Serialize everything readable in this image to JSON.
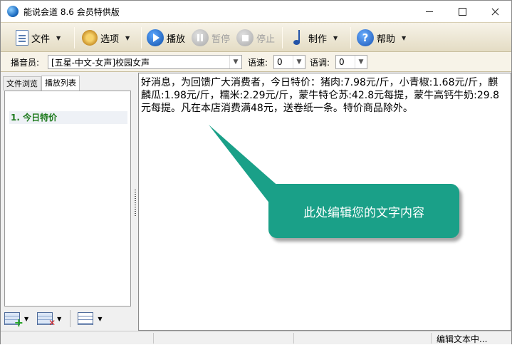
{
  "window": {
    "title": "能说会道 8.6 会员特供版"
  },
  "toolbar": {
    "file_label": "文件",
    "options_label": "选项",
    "play_label": "播放",
    "pause_label": "暂停",
    "stop_label": "停止",
    "make_label": "制作",
    "help_label": "帮助"
  },
  "voicebar": {
    "announcer_label": "播音员:",
    "announcer_value": "[五星-中文-女声]校园女声",
    "speed_label": "语速:",
    "speed_value": "0",
    "pitch_label": "语调:",
    "pitch_value": "0"
  },
  "left_panel": {
    "tabs": [
      {
        "label": "文件浏览",
        "active": false
      },
      {
        "label": "播放列表",
        "active": true
      }
    ],
    "playlist": [
      {
        "label": "1. 今日特价",
        "selected": true
      }
    ]
  },
  "editor": {
    "text": "好消息，为回馈广大消费者，今日特价：猪肉:7.98元/斤，小青椒:1.68元/斤，麒麟瓜:1.98元/斤，糯米:2.29元/斤，蒙牛特仑苏:42.8元每提，蒙牛高钙牛奶:29.8元每提。凡在本店消费满48元，送卷纸一条。特价商品除外。"
  },
  "callout": {
    "text": "此处编辑您的文字内容",
    "color": "#1aa088"
  },
  "statusbar": {
    "status_text": "编辑文本中..."
  },
  "colors": {
    "toolbar_bg": "#ebe4cf",
    "playlist_text": "#1d7a1d",
    "accent_blue": "#1f5fb8"
  }
}
